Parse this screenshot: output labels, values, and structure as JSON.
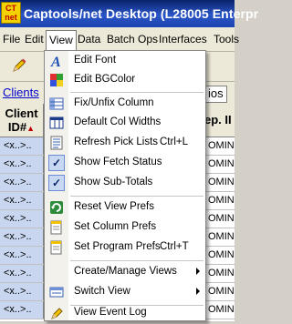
{
  "window": {
    "logo_top": "CT",
    "logo_bottom": "net",
    "title": "Captools/net Desktop  (L28005 Enterpr"
  },
  "menubar": {
    "items": [
      {
        "label": "File"
      },
      {
        "label": "Edit"
      },
      {
        "label": "View"
      },
      {
        "label": "Data"
      },
      {
        "label": "Batch Ops"
      },
      {
        "label": "Interfaces"
      },
      {
        "label": "Tools"
      }
    ]
  },
  "toolbar": {
    "icon": "pencil-icon"
  },
  "tabs": {
    "left": "Clients",
    "right": "ios"
  },
  "grid": {
    "header_client": "Client",
    "header_id": "ID#",
    "header_right": "ep. II",
    "rows": [
      {
        "id": "<x..>..",
        "right": "OMIN"
      },
      {
        "id": "<x..>..",
        "right": "OMIN"
      },
      {
        "id": "<x..>..",
        "right": "OMIN"
      },
      {
        "id": "<x..>..",
        "right": "OMIN"
      },
      {
        "id": "<x..>..",
        "right": "OMIN"
      },
      {
        "id": "<x..>..",
        "right": "OMIN"
      },
      {
        "id": "<x..>..",
        "right": "OMIN"
      },
      {
        "id": "<x..>..",
        "right": "OMIN"
      },
      {
        "id": "<x..>..",
        "right": "OMIN"
      },
      {
        "id": "<x..>..",
        "right": "OMIN"
      }
    ]
  },
  "view_menu": {
    "edit_font": {
      "label": "Edit Font",
      "icon": "font-icon"
    },
    "edit_bgcolor": {
      "label": "Edit BGColor",
      "icon": "color-palette-icon"
    },
    "fix_column": {
      "label": "Fix/Unfix Column",
      "icon": "fix-column-icon"
    },
    "default_widths": {
      "label": "Default Col Widths",
      "icon": "column-widths-icon"
    },
    "refresh_pick": {
      "label": "Refresh Pick Lists",
      "shortcut": "Ctrl+L",
      "icon": "refresh-list-icon"
    },
    "show_fetch": {
      "label": "Show Fetch Status",
      "checked": true
    },
    "show_subtotals": {
      "label": "Show Sub-Totals",
      "checked": true
    },
    "reset_prefs": {
      "label": "Reset View Prefs",
      "icon": "reset-icon"
    },
    "set_col_prefs": {
      "label": "Set Column Prefs",
      "icon": "column-prefs-icon"
    },
    "set_prog_prefs": {
      "label": "Set Program Prefs",
      "shortcut": "Ctrl+T",
      "icon": "program-prefs-icon"
    },
    "create_views": {
      "label": "Create/Manage Views",
      "has_submenu": true
    },
    "switch_view": {
      "label": "Switch View",
      "has_submenu": true,
      "icon": "switch-view-icon"
    },
    "event_log": {
      "label": "View Event Log",
      "icon": "event-log-icon"
    }
  }
}
